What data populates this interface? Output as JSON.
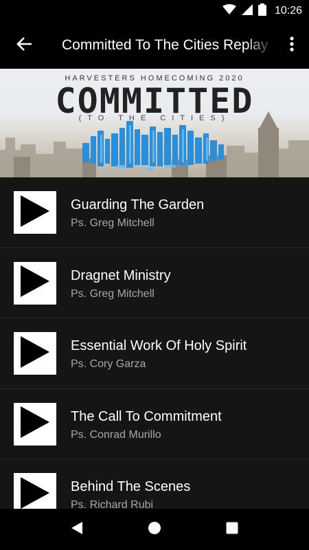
{
  "status_bar": {
    "time": "10:26",
    "icons": [
      "wifi-icon",
      "cell-signal-icon",
      "battery-icon"
    ]
  },
  "app_bar": {
    "title": "Committed To The Cities Replay",
    "back_icon": "arrow-back-icon",
    "menu_icon": "more-vert-icon"
  },
  "banner": {
    "kicker": "HARVESTERS HOMECOMING 2020",
    "title": "COMMITTED",
    "subtitle": "(TO THE CITIES)"
  },
  "episodes": [
    {
      "title": "Guarding The Garden",
      "speaker": "Ps. Greg Mitchell"
    },
    {
      "title": "Dragnet Ministry",
      "speaker": "Ps. Greg Mitchell"
    },
    {
      "title": "Essential Work Of Holy Spirit",
      "speaker": "Ps. Cory Garza"
    },
    {
      "title": "The Call To Commitment",
      "speaker": "Ps. Conrad Murillo"
    },
    {
      "title": "Behind The Scenes",
      "speaker": "Ps. Richard Rubi"
    }
  ],
  "nav_bar": {
    "icons": [
      "nav-back-icon",
      "nav-home-icon",
      "nav-recents-icon"
    ]
  },
  "colors": {
    "background": "#151515",
    "title_text": "#ffffff",
    "subtitle_text": "#a8a8a8",
    "accent_city": "#2a8fd8"
  }
}
